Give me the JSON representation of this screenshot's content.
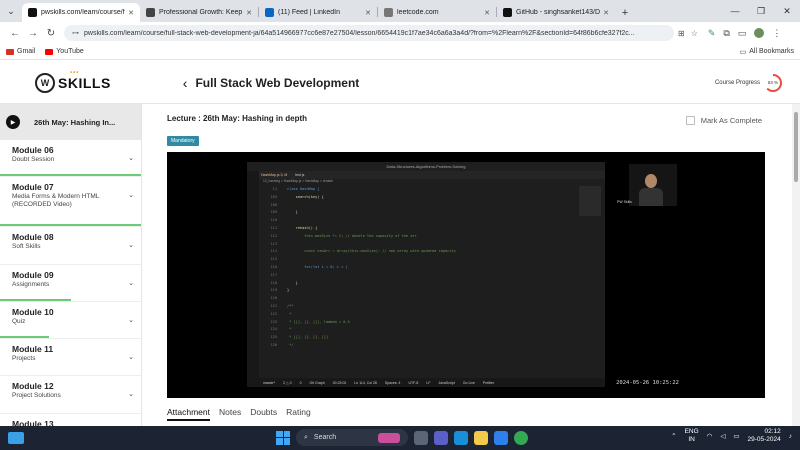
{
  "browser": {
    "tabs": [
      {
        "title": "pwskills.com/learn/course/full",
        "favicon_color": "#111111",
        "active": true
      },
      {
        "title": "Professional Growth: Keep Pus",
        "favicon_color": "#444444",
        "active": false
      },
      {
        "title": "(11) Feed | LinkedIn",
        "favicon_color": "#0a66c2",
        "active": false
      },
      {
        "title": "leetcode.com",
        "favicon_color": "#777777",
        "active": false
      },
      {
        "title": "GitHub - singhsanket143/Data",
        "favicon_color": "#111111",
        "active": false
      }
    ],
    "new_tab_symbol": "+",
    "url": "pwskills.com/learn/course/full-stack-web-development-ja/64a514966977cc6e87e27504/lesson/6654419c1f7ae34c6a6a3a4d/?from=%2Flearn%2F&sectionId=64f86b6cfe327f2c...",
    "bookmarks": [
      {
        "label": "Gmail",
        "color": "#d93025"
      },
      {
        "label": "YouTube",
        "color": "#ff0000"
      }
    ],
    "all_bookmarks_label": "All Bookmarks"
  },
  "header": {
    "logo_text": "SKILLS",
    "logo_mark": "W",
    "course_title": "Full Stack Web Development",
    "progress_label": "Course Progress",
    "progress_value": "63 %",
    "progress_percent": 63
  },
  "sidebar": {
    "current_lecture": "26th May: Hashing In...",
    "modules": [
      {
        "title": "Module 06",
        "subtitle": "Doubt Session",
        "progress": 1.0
      },
      {
        "title": "Module 07",
        "subtitle": "Media Forms & Modern HTML (RECORDED Video)",
        "progress": 1.0
      },
      {
        "title": "Module 08",
        "subtitle": "Soft Skills",
        "progress": 0.0
      },
      {
        "title": "Module 09",
        "subtitle": "Assignments",
        "progress": 0.5
      },
      {
        "title": "Module 10",
        "subtitle": "Quiz",
        "progress": 0.35
      },
      {
        "title": "Module 11",
        "subtitle": "Projects",
        "progress": 0.0
      },
      {
        "title": "Module 12",
        "subtitle": "Project Solutions",
        "progress": 0.0
      },
      {
        "title": "Module 13",
        "subtitle": "",
        "progress": 0.0
      }
    ]
  },
  "main": {
    "lecture_title": "Lecture : 26th May: Hashing in depth",
    "badge": "Mandatory",
    "mark_complete": "Mark As Complete",
    "tabs": [
      "Attachment",
      "Notes",
      "Doubts",
      "Rating"
    ]
  },
  "video": {
    "window_title": "Data-Structures-Algorithms-Problem-Solving",
    "editor_tabs": [
      "HashMap.js 3, M",
      "test.js"
    ],
    "breadcrumb": "13_hashing > HashMap.js > HashMap > rehash",
    "code_lines": [
      {
        "n": "11",
        "code": "class HashMap {"
      },
      {
        "n": "103",
        "code": "    search(key) {"
      },
      {
        "n": "108",
        "code": ""
      },
      {
        "n": "109",
        "code": "    }"
      },
      {
        "n": "110",
        "code": ""
      },
      {
        "n": "111",
        "code": "    rehash() {"
      },
      {
        "n": "112",
        "code": "        this.maxSize *= 2; // double the capacity of the arr"
      },
      {
        "n": "113",
        "code": ""
      },
      {
        "n": "114",
        "code": "        const newArr = Array(this.maxSize); // new array with updated capacity"
      },
      {
        "n": "115",
        "code": ""
      },
      {
        "n": "116",
        "code": "        for(let i = 0; i < )"
      },
      {
        "n": "117",
        "code": ""
      },
      {
        "n": "118",
        "code": "    }"
      },
      {
        "n": "119",
        "code": "}"
      },
      {
        "n": "120",
        "code": ""
      },
      {
        "n": "121",
        "code": "/**"
      },
      {
        "n": "122",
        "code": " *"
      },
      {
        "n": "123",
        "code": " * [[], [], []], lambda = 0.5"
      },
      {
        "n": "124",
        "code": " *"
      },
      {
        "n": "125",
        "code": " * [[], [], [], []]"
      },
      {
        "n": "126",
        "code": " */"
      }
    ],
    "status_items": [
      "master*",
      "2 △ 0",
      "0",
      "Git Graph",
      "00:23:02",
      "Ln 114, Col 28",
      "Spaces: 4",
      "UTF-8",
      "LF",
      "JavaScript",
      "Go Live",
      "Prettier"
    ],
    "cam_name": "PW Skills",
    "timestamp": "2024-05-26 10:25:22"
  },
  "taskbar": {
    "search_label": "Search",
    "lang_top": "ENG",
    "lang_bottom": "IN",
    "time": "02:12",
    "date": "29-05-2024"
  }
}
